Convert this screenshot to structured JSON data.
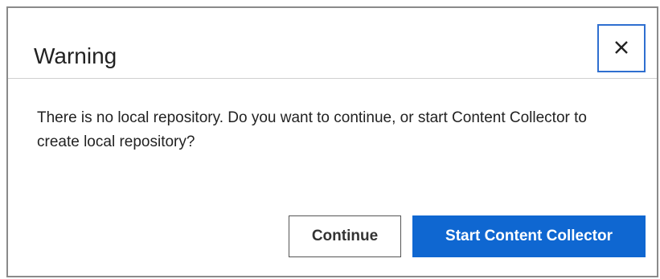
{
  "dialog": {
    "title": "Warning",
    "close_icon": "close-icon",
    "message": "There is no local repository. Do you want to continue, or start Content Collector to create local repository?",
    "buttons": {
      "continue_label": "Continue",
      "start_label": "Start Content Collector"
    }
  },
  "colors": {
    "primary": "#0f67d1",
    "focus_border": "#2f6fd0",
    "text": "#222222"
  }
}
